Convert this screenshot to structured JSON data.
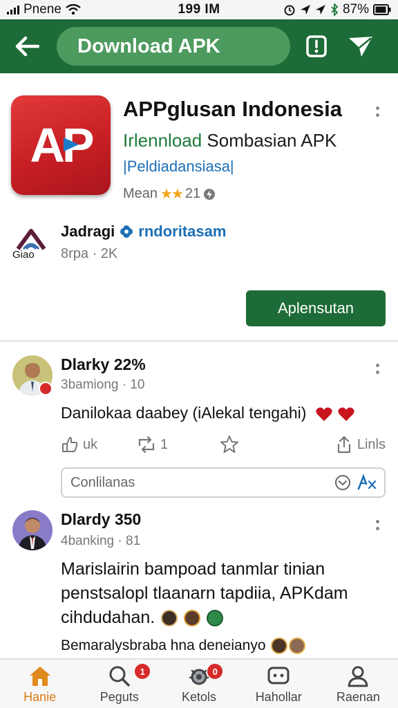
{
  "status_bar": {
    "carrier": "Pnene",
    "time": "199 IM",
    "battery": "87%"
  },
  "app_bar": {
    "title": "Download APK"
  },
  "app": {
    "logo_text": "AP",
    "title": "APPglusan Indonesia",
    "subtitle_green": "Irlennload",
    "subtitle_rest": " Sombasian APK",
    "tag": "|Peldiadansiasa|",
    "rating_label": "Mean",
    "rating_stars": "★★",
    "rating_value": "21",
    "developer_name": "Jadragi",
    "developer_verified": "rndoritasam",
    "developer_logo_caption": "Giao",
    "developer_meta": "8rpa · 2K",
    "install_label": "Aplensutan"
  },
  "posts": [
    {
      "user": "Dlarky 22%",
      "meta": "3bamiong · 10",
      "text": "Danilokaa daabey (iAlekal tengahi)",
      "actions": {
        "like_label": "uk",
        "repost_count": "1",
        "share_label": "Linls"
      },
      "comment_placeholder": "Conlilanas"
    },
    {
      "user": "Dlardy 350",
      "meta": "4banking · 81",
      "text_line_1": "Marislairin bampoad tanmlar tinian",
      "text_line_2": "penstsalopl tlaanarn tapdiia, APKdam",
      "text_line_3": "cihdudahan.",
      "footer_text": "Bemaralysbraba hna deneianyo"
    }
  ],
  "bottom_nav": {
    "items": [
      {
        "label": "Hanie",
        "icon": "home-icon",
        "active": true
      },
      {
        "label": "Peguts",
        "icon": "search-icon",
        "badge": "1"
      },
      {
        "label": "Ketols",
        "icon": "bug-icon",
        "badge": "0"
      },
      {
        "label": "Hahollar",
        "icon": "chat-icon"
      },
      {
        "label": "Raenan",
        "icon": "profile-icon"
      }
    ]
  },
  "colors": {
    "app_bar": "#1d6b37",
    "accent_green": "#1d7a3a",
    "logo_red": "#d42a2e",
    "link_blue": "#1c6fb6",
    "star": "#f2a51a",
    "active_nav": "#d77a12"
  }
}
